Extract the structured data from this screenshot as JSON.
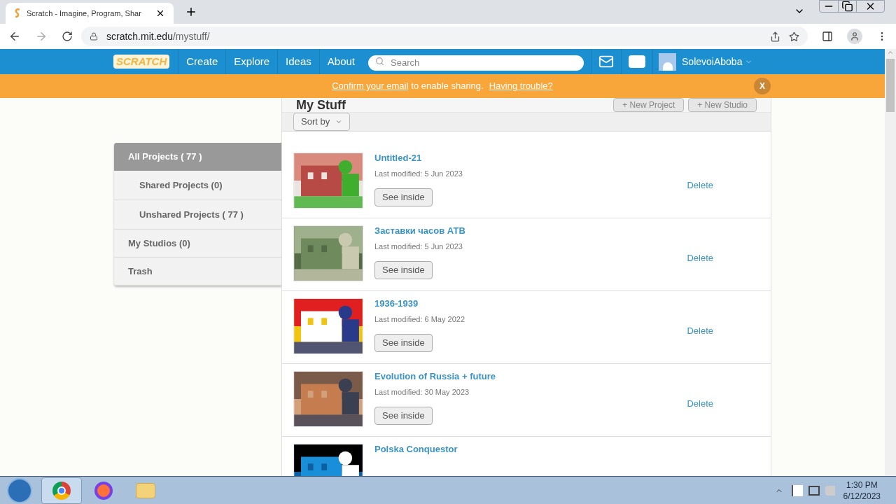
{
  "browser": {
    "tab_title": "Scratch - Imagine, Program, Shar",
    "url_host": "scratch.mit.edu",
    "url_path": "/mystuff/"
  },
  "nav": {
    "logo": "SCRATCH",
    "links": [
      "Create",
      "Explore",
      "Ideas",
      "About"
    ],
    "search": {
      "placeholder": "Search"
    },
    "username": "SolevoiAboba"
  },
  "banner": {
    "link1": "Confirm your email",
    "text": "to enable sharing.",
    "link2": "Having trouble?",
    "close": "X"
  },
  "page": {
    "title": "My Stuff",
    "buttons": [
      "+ New Project",
      "+ New Studio"
    ],
    "sort": "Sort by"
  },
  "sidebar": [
    {
      "label": "All Projects ( 77 )",
      "selected": true,
      "children": [
        {
          "label": "Shared Projects (0)",
          "selected": false
        },
        {
          "label": "Unshared Projects ( 77 )",
          "selected": false
        }
      ]
    },
    {
      "label": "My Studios (0)",
      "selected": false
    },
    {
      "label": "Trash",
      "selected": false
    }
  ],
  "projects": [
    {
      "title": "Untitled-21",
      "modified": "Last modified: 5 Jun 2023",
      "button": "See inside",
      "delete": "Delete"
    },
    {
      "title": "Заставки часов АТВ",
      "modified": "Last modified: 5 Jun 2023",
      "button": "See inside",
      "delete": "Delete"
    },
    {
      "title": "1936-1939",
      "modified": "Last modified: 6 May 2022",
      "button": "See inside",
      "delete": "Delete"
    },
    {
      "title": "Evolution of Russia + future",
      "modified": "Last modified: 30 May 2023",
      "button": "See inside",
      "delete": "Delete"
    },
    {
      "title": "Polska Conquestor"
    }
  ],
  "taskbar": {
    "time": "1:30 PM",
    "date": "6/12/2023"
  }
}
